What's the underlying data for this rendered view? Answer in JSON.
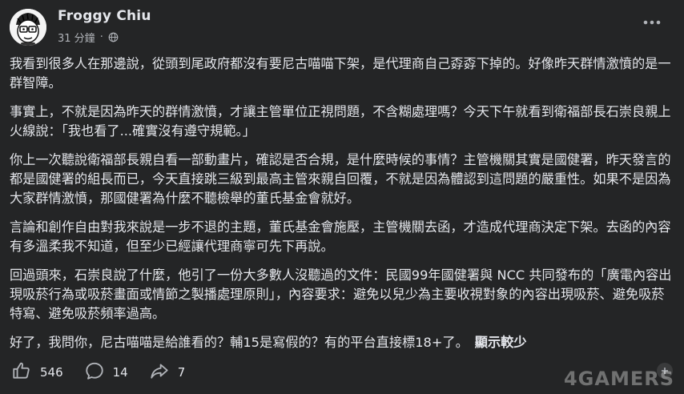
{
  "post": {
    "author": "Froggy Chiu",
    "time": "31 分鐘",
    "separator": "·",
    "visibility_icon": "globe-icon",
    "more_icon": "more-options-icon",
    "paragraphs": [
      "我看到很多人在那邊說，從頭到尾政府都沒有要尼古喵喵下架，是代理商自己孬孬下掉的。好像昨天群情激憤的是一群智障。",
      "事實上，不就是因為昨天的群情激憤，才讓主管單位正視問題，不含糊處理嗎？今天下午就看到衛福部長石崇良親上火線說：「我也看了...確實沒有遵守規範。」",
      "你上一次聽說衛福部長親自看一部動畫片，確認是否合規，是什麼時候的事情？主管機關其實是國健署，昨天發言的都是國健署的組長而已，今天直接跳三級到最高主管來親自回覆，不就是因為體認到這問題的嚴重性。如果不是因為大家群情激憤，那國健署為什麼不聽檢舉的董氏基金會就好。",
      "言論和創作自由對我來說是一步不退的主題，董氏基金會施壓，主管機關去函，才造成代理商決定下架。去函的內容有多溫柔我不知道，但至少已經讓代理商寧可先下再說。",
      "回過頭來，石崇良說了什麼，他引了一份大多數人沒聽過的文件：民國99年國健署與 NCC 共同發布的「廣電內容出現吸菸行為或吸菸畫面或情節之製播處理原則」，內容要求：避免以兒少為主要收視對象的內容出現吸菸、避免吸菸特寫、避免吸菸頻率過高。",
      "好了，我問你，尼古喵喵是給誰看的？輔15是寫假的？有的平台直接標18+了。"
    ],
    "see_less": "顯示較少"
  },
  "actions": {
    "like_icon": "like-icon",
    "like_count": "546",
    "comment_icon": "comment-icon",
    "comment_count": "14",
    "share_icon": "share-icon",
    "share_count": "7"
  },
  "watermark": "4GAMERS",
  "colors": {
    "background": "#242526",
    "text": "#e4e6eb",
    "secondary_text": "#b0b3b8"
  }
}
